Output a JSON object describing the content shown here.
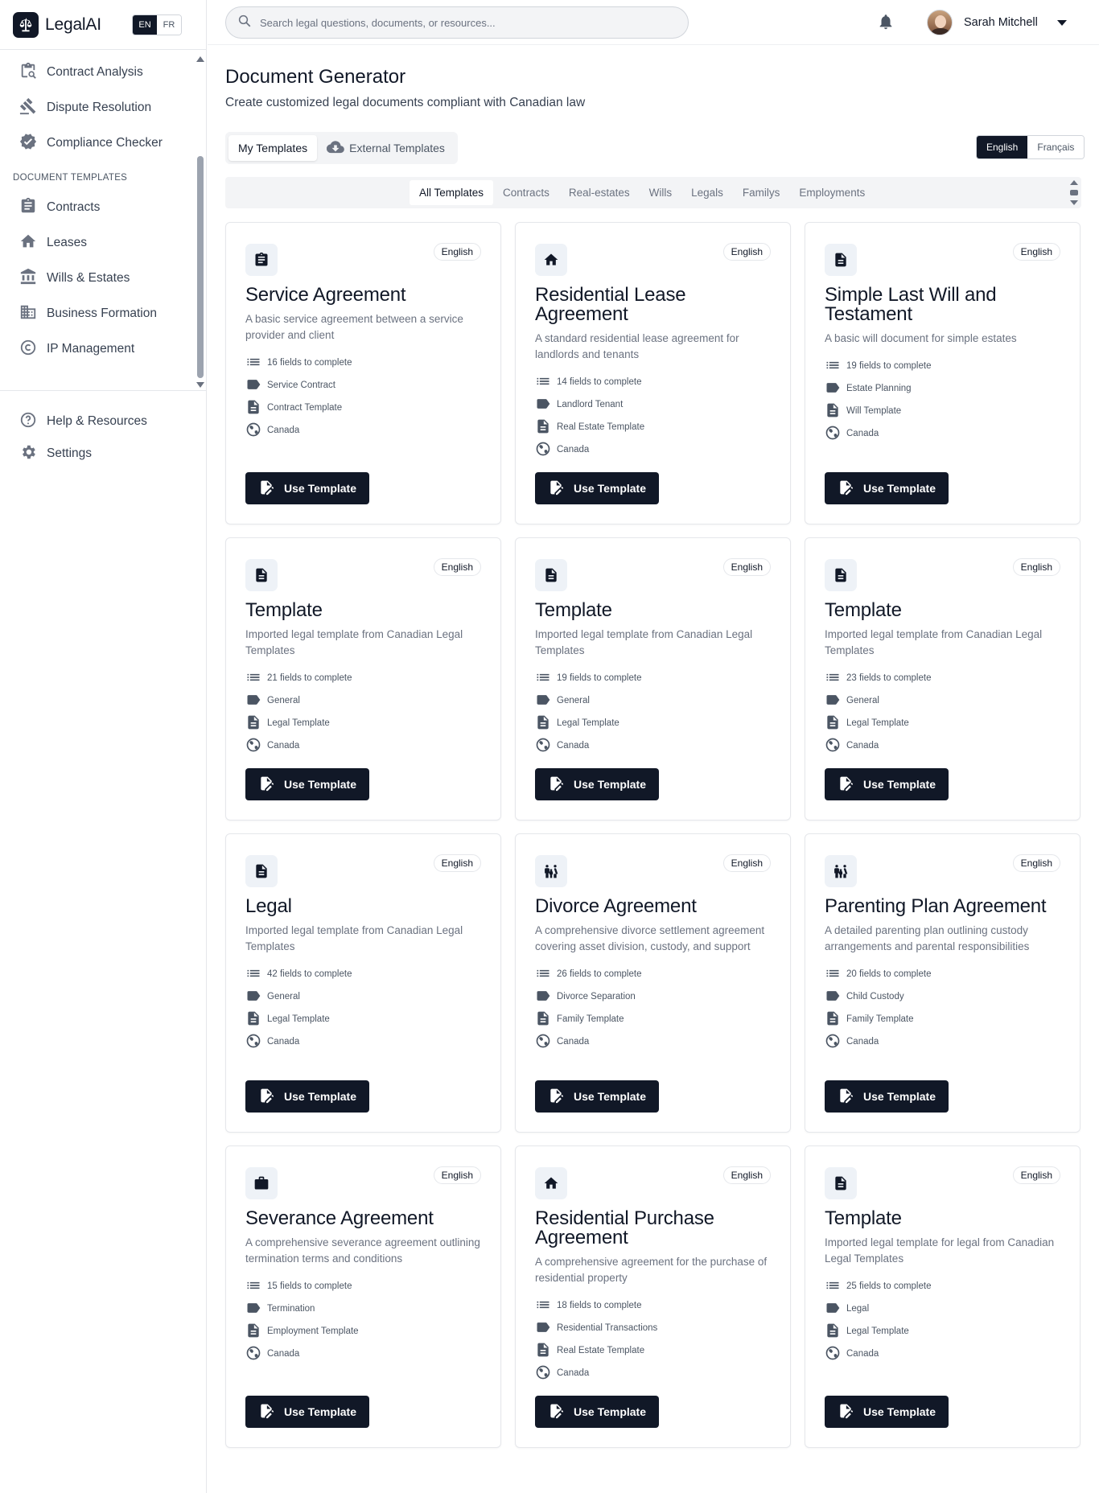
{
  "app": {
    "name": "LegalAI",
    "lang_en": "EN",
    "lang_fr": "FR"
  },
  "sidebar": {
    "items": [
      {
        "label": "Contract Analysis",
        "icon": "contract-analysis-icon"
      },
      {
        "label": "Dispute Resolution",
        "icon": "gavel-icon"
      },
      {
        "label": "Compliance Checker",
        "icon": "verified-badge-icon"
      }
    ],
    "section_title": "DOCUMENT TEMPLATES",
    "templates": [
      {
        "label": "Contracts",
        "icon": "clipboard-icon"
      },
      {
        "label": "Leases",
        "icon": "home-icon"
      },
      {
        "label": "Wills & Estates",
        "icon": "bank-icon"
      },
      {
        "label": "Business Formation",
        "icon": "building-icon"
      },
      {
        "label": "IP Management",
        "icon": "copyright-icon"
      }
    ],
    "footer": [
      {
        "label": "Help & Resources",
        "icon": "help-icon"
      },
      {
        "label": "Settings",
        "icon": "gear-icon"
      }
    ]
  },
  "header": {
    "search_placeholder": "Search legal questions, documents, or resources...",
    "user_name": "Sarah Mitchell"
  },
  "main": {
    "title": "Document Generator",
    "subtitle": "Create customized legal documents compliant with Canadian law",
    "tabs": [
      "My Templates",
      "External Templates"
    ],
    "language_switch": [
      "English",
      "Français"
    ],
    "categories": [
      "All Templates",
      "Contracts",
      "Real-estates",
      "Wills",
      "Legals",
      "Familys",
      "Employments"
    ]
  },
  "cards": [
    {
      "icon": "clipboard-icon",
      "badge": "English",
      "title": "Service Agreement",
      "desc": "A basic service agreement between a service provider and client",
      "fields": "16 fields to complete",
      "tag": "Service Contract",
      "type": "Contract Template",
      "region": "Canada",
      "button": "Use Template"
    },
    {
      "icon": "home-icon",
      "badge": "English",
      "title": "Residential Lease Agreement",
      "desc": "A standard residential lease agreement for landlords and tenants",
      "fields": "14 fields to complete",
      "tag": "Landlord Tenant",
      "type": "Real Estate Template",
      "region": "Canada",
      "button": "Use Template"
    },
    {
      "icon": "document-icon",
      "badge": "English",
      "title": "Simple Last Will and Testament",
      "desc": "A basic will document for simple estates",
      "fields": "19 fields to complete",
      "tag": "Estate Planning",
      "type": "Will Template",
      "region": "Canada",
      "button": "Use Template"
    },
    {
      "icon": "document-icon",
      "badge": "English",
      "title": "Template",
      "desc": "Imported legal template from Canadian Legal Templates",
      "fields": "21 fields to complete",
      "tag": "General",
      "type": "Legal Template",
      "region": "Canada",
      "button": "Use Template"
    },
    {
      "icon": "document-icon",
      "badge": "English",
      "title": "Template",
      "desc": "Imported legal template from Canadian Legal Templates",
      "fields": "19 fields to complete",
      "tag": "General",
      "type": "Legal Template",
      "region": "Canada",
      "button": "Use Template"
    },
    {
      "icon": "document-icon",
      "badge": "English",
      "title": "Template",
      "desc": "Imported legal template from Canadian Legal Templates",
      "fields": "23 fields to complete",
      "tag": "General",
      "type": "Legal Template",
      "region": "Canada",
      "button": "Use Template"
    },
    {
      "icon": "document-icon",
      "badge": "English",
      "title": "Legal",
      "desc": "Imported legal template from Canadian Legal Templates",
      "fields": "42 fields to complete",
      "tag": "General",
      "type": "Legal Template",
      "region": "Canada",
      "button": "Use Template"
    },
    {
      "icon": "family-icon",
      "badge": "English",
      "title": "Divorce Agreement",
      "desc": "A comprehensive divorce settlement agreement covering asset division, custody, and support",
      "fields": "26 fields to complete",
      "tag": "Divorce Separation",
      "type": "Family Template",
      "region": "Canada",
      "button": "Use Template"
    },
    {
      "icon": "family-icon",
      "badge": "English",
      "title": "Parenting Plan Agreement",
      "desc": "A detailed parenting plan outlining custody arrangements and parental responsibilities",
      "fields": "20 fields to complete",
      "tag": "Child Custody",
      "type": "Family Template",
      "region": "Canada",
      "button": "Use Template"
    },
    {
      "icon": "briefcase-icon",
      "badge": "English",
      "title": "Severance Agreement",
      "desc": "A comprehensive severance agreement outlining termination terms and conditions",
      "fields": "15 fields to complete",
      "tag": "Termination",
      "type": "Employment Template",
      "region": "Canada",
      "button": "Use Template"
    },
    {
      "icon": "home-icon",
      "badge": "English",
      "title": "Residential Purchase Agreement",
      "desc": "A comprehensive agreement for the purchase of residential property",
      "fields": "18 fields to complete",
      "tag": "Residential Transactions",
      "type": "Real Estate Template",
      "region": "Canada",
      "button": "Use Template"
    },
    {
      "icon": "document-icon",
      "badge": "English",
      "title": "Template",
      "desc": "Imported legal template for legal from Canadian Legal Templates",
      "fields": "25 fields to complete",
      "tag": "Legal",
      "type": "Legal Template",
      "region": "Canada",
      "button": "Use Template"
    }
  ]
}
